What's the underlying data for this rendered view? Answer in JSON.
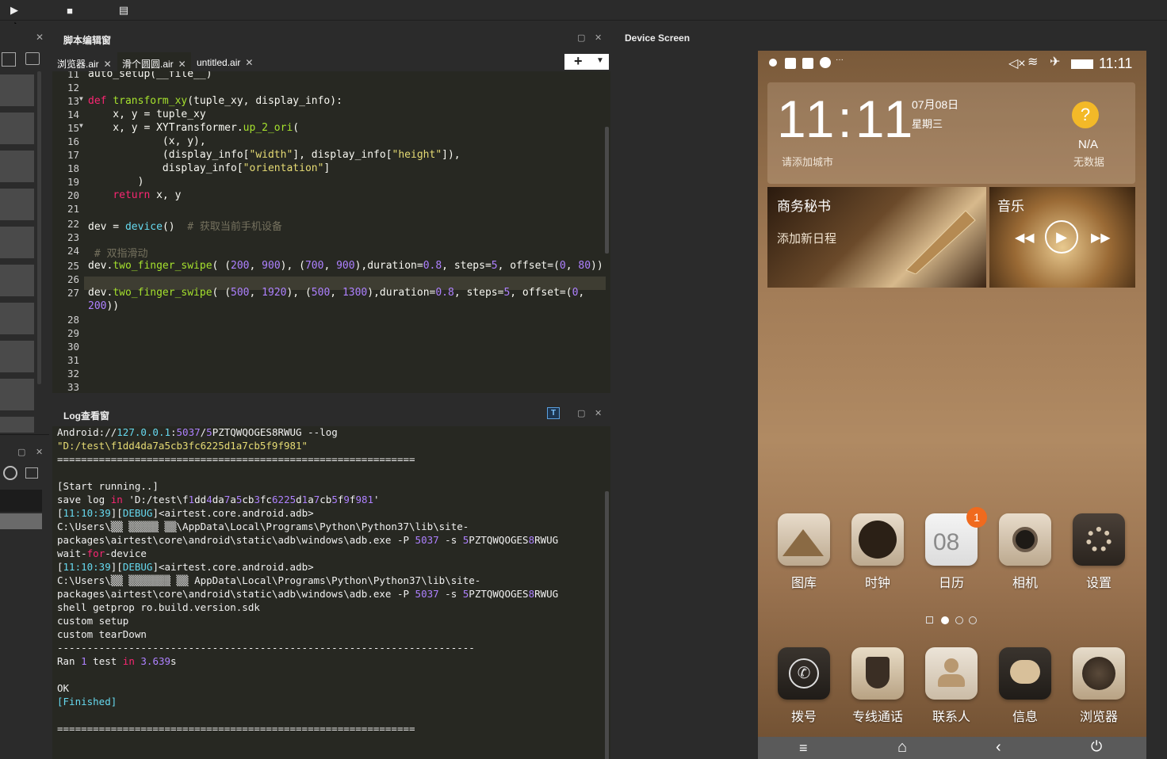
{
  "toolbar": {
    "play_icon": "play-icon",
    "stop_icon": "stop-icon",
    "menu_icon": "list-icon"
  },
  "editor": {
    "title": "脚本编辑窗",
    "tabs": [
      {
        "label": "浏览器.air",
        "close": "✕"
      },
      {
        "label": "滑个圆圆.air",
        "close": "✕"
      },
      {
        "label": "untitled.air",
        "close": "✕"
      }
    ],
    "add_label": "+",
    "code_top": "auto_setup(__file__)",
    "line_numbers": [
      "11",
      "12",
      "13",
      "14",
      "15",
      "16",
      "17",
      "18",
      "19",
      "20",
      "21",
      "22",
      "23",
      "24",
      "25",
      "26",
      "27",
      "",
      "28",
      "29",
      "30",
      "31",
      "32",
      "33"
    ]
  },
  "log": {
    "title": "Log查看窗",
    "lines": [
      "Android://127.0.0.1:5037/5PZTQWQOGES8RWUG --log",
      "\"D:/test\\f1dd4da7a5cb3fc6225d1a7cb5f9f981\"",
      "============================================================",
      "",
      "[Start running..]",
      "save log in 'D:/test\\f1dd4da7a5cb3fc6225d1a7cb5f9f981'",
      "[11:10:39][DEBUG]<airtest.core.android.adb>",
      "C:\\Users\\▒▒ ▒▒▒▒▒ ▒▒\\AppData\\Local\\Programs\\Python\\Python37\\lib\\site-",
      "packages\\airtest\\core\\android\\static\\adb\\windows\\adb.exe -P 5037 -s 5PZTQWQOGES8RWUG",
      "wait-for-device",
      "[11:10:39][DEBUG]<airtest.core.android.adb>",
      "C:\\Users\\▒▒ ▒▒▒▒▒▒▒ ▒▒ AppData\\Local\\Programs\\Python\\Python37\\lib\\site-",
      "packages\\airtest\\core\\android\\static\\adb\\windows\\adb.exe -P 5037 -s 5PZTQWQOGES8RWUG",
      "shell getprop ro.build.version.sdk",
      "custom setup",
      "custom tearDown",
      "----------------------------------------------------------------------",
      "Ran 1 test in 3.639s",
      "",
      "OK",
      "[Finished]",
      "",
      "============================================================"
    ]
  },
  "device": {
    "title": "Device Screen",
    "time": "11:11",
    "clock": "11:11",
    "date": "07月08日",
    "weekday": "星期三",
    "city": "请添加城市",
    "weather": "N/A",
    "weather_sub": "无数据",
    "card1_title": "商务秘书",
    "card1_sub": "添加新日程",
    "card2_title": "音乐",
    "calendar_day": "08",
    "badge": "1",
    "apps_row1": [
      "图库",
      "时钟",
      "日历",
      "相机",
      "设置"
    ],
    "apps_row2": [
      "拨号",
      "专线通话",
      "联系人",
      "信息",
      "浏览器"
    ]
  }
}
